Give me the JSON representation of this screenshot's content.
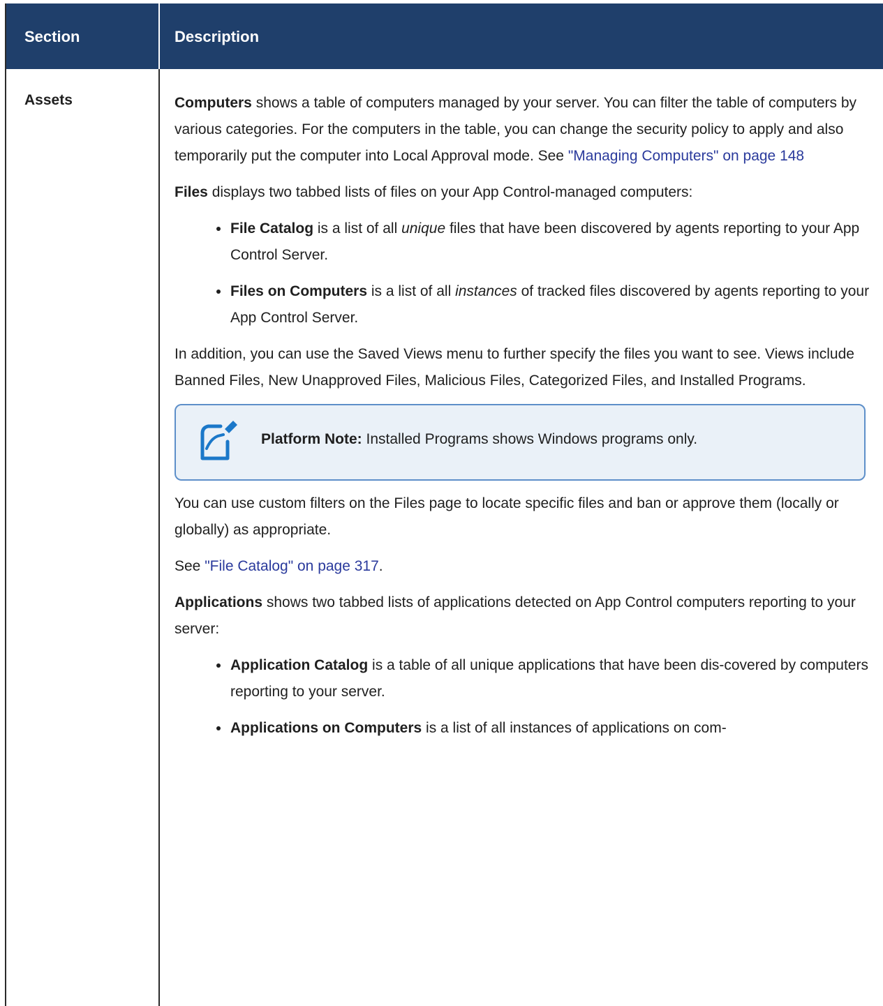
{
  "header": {
    "col_section": "Section",
    "col_description": "Description"
  },
  "row": {
    "section": "Assets",
    "p1": {
      "bold": "Computers",
      "text": " shows a table of computers managed by your server. You can filter the table of computers by various categories. For the computers in the table, you can change the security policy to apply and also temporarily put the computer into Local Approval mode. See ",
      "link": "\"Managing Computers\" on page 148"
    },
    "p2": {
      "bold": "Files",
      "text": " displays two tabbed lists of files on your App Control-managed computers:"
    },
    "files_list": [
      {
        "bold": "File Catalog",
        "pre": " is a list of all ",
        "em": "unique",
        "post": " files that have been discovered by agents reporting to your App Control Server."
      },
      {
        "bold": "Files on Computers",
        "pre": " is a list of all ",
        "em": "instances",
        "post": " of tracked files discovered by agents reporting to your App Control Server."
      }
    ],
    "p3": "In addition, you can use the Saved Views menu to further specify the files you want to see. Views include Banned Files, New Unapproved Files, Malicious Files, Categorized Files, and Installed Programs.",
    "note": {
      "label": "Platform Note:",
      "text": " Installed Programs shows Windows programs only.",
      "icon": "note-icon"
    },
    "p4": "You can use custom filters on the Files page to locate specific files and ban or approve them (locally or globally) as appropriate.",
    "p5": {
      "pre": "See ",
      "link": "\"File Catalog\" on page 317",
      "post": "."
    },
    "p6": {
      "bold": "Applications",
      "text": " shows two tabbed lists of applications detected on App Control computers reporting to your server:"
    },
    "apps_list": [
      {
        "bold": "Application Catalog",
        "text": " is a table of all unique applications that have been dis-covered by computers reporting to your server."
      },
      {
        "bold": "Applications on Computers",
        "text": " is a list of all instances of applications on com-"
      }
    ]
  },
  "colors": {
    "header_bg": "#1f3f6b",
    "link": "#2a3a9c",
    "note_border": "#5d8fc9",
    "note_bg": "#eaf1f8"
  }
}
